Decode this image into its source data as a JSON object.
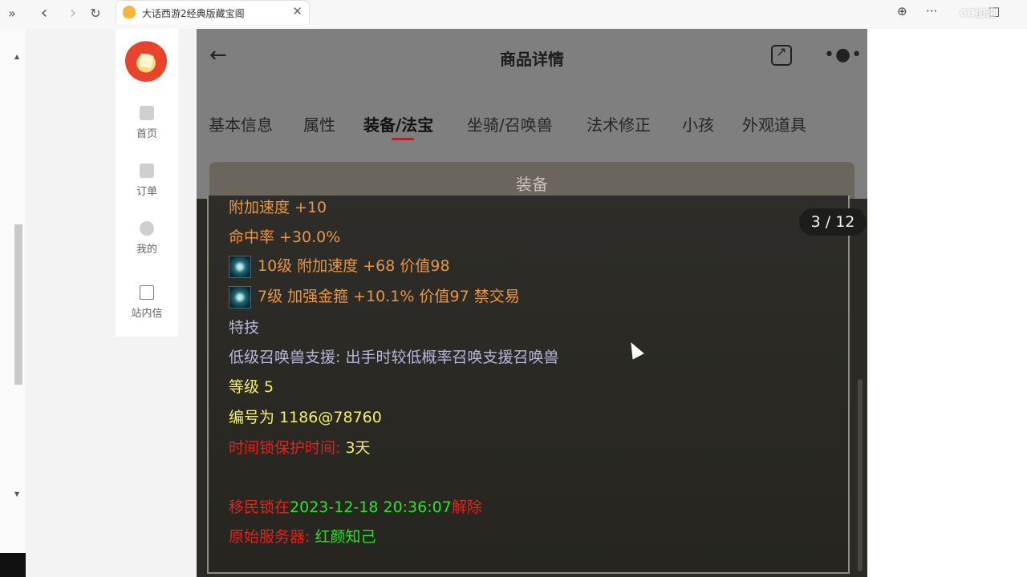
{
  "browser": {
    "tab_title": "大话西游2经典版藏宝阁",
    "nav": {
      "back": "‹",
      "forward": "›",
      "reload": "↻",
      "more": "···",
      "sidebar_toggle": "»",
      "close_tab": "✕",
      "globe": "⊕",
      "minimize": "—",
      "maximize": "□"
    },
    "watermark": "CC加速"
  },
  "sidebar": {
    "items": [
      {
        "label": "首页",
        "icon": "home-icon"
      },
      {
        "label": "订单",
        "icon": "order-icon"
      },
      {
        "label": "我的",
        "icon": "user-icon"
      },
      {
        "label": "站内信",
        "icon": "mail-icon"
      }
    ]
  },
  "header": {
    "title": "商品详情",
    "back_icon": "←",
    "more_icon": "•●•"
  },
  "tabs": [
    {
      "label": "基本信息"
    },
    {
      "label": "属性"
    },
    {
      "label": "装备/法宝",
      "active": true
    },
    {
      "label": "坐骑/召唤兽"
    },
    {
      "label": "法术修正"
    },
    {
      "label": "小孩"
    },
    {
      "label": "外观道具"
    }
  ],
  "section": {
    "title": "装备"
  },
  "pager": {
    "current": 3,
    "total": 12,
    "text": "3 / 12"
  },
  "details": {
    "line1": "附加速度 +10",
    "line2": "命中率 +30.0%",
    "gem1": "10级 附加速度 +68 价值98",
    "gem2": "7级 加强金箍 +10.1% 价值97 禁交易",
    "skill_title": "特技",
    "skill_desc": "低级召唤兽支援: 出手时较低概率召唤支援召唤兽",
    "level": "等级 5",
    "serial": "编号为 1186@78760",
    "lock_label": "时间锁保护时间:",
    "lock_value": "3天",
    "migrate_prefix": "移民锁在",
    "migrate_time": "2023-12-18 20:36:07",
    "migrate_suffix": "解除",
    "server_label": "原始服务器:",
    "server_value": "红颜知己"
  },
  "colors": {
    "orange": "#e89548",
    "lavender": "#b8b6d8",
    "yellow": "#f2ef6e",
    "red": "#e3211d",
    "green": "#2fe02c",
    "accent": "#a5282a"
  }
}
